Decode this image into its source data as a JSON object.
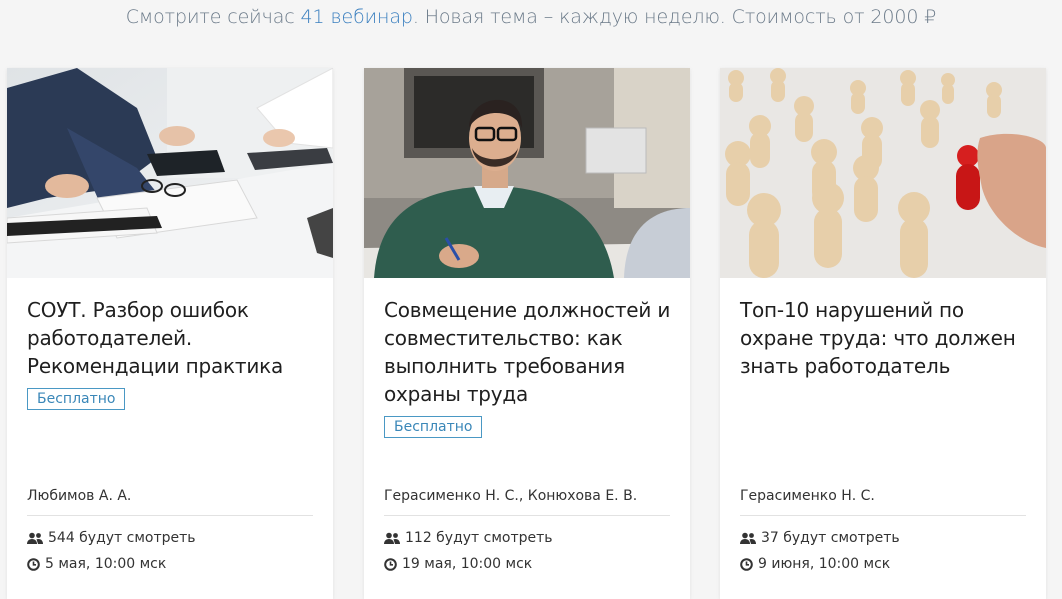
{
  "header": {
    "prefix": "Смотрите сейчас ",
    "count_link": "41 вебинар",
    "suffix": ". Новая тема – каждую неделю. Стоимость от 2000 ₽"
  },
  "cards": [
    {
      "image": "office-documents-tablet-calculator",
      "title": "СОУТ. Разбор ошибок работодателей. Рекомендации практика",
      "badge": "Бесплатно",
      "authors": "Любимов А. А.",
      "watchers": "544 будут смотреть",
      "date": "5 мая, 10:00 мск"
    },
    {
      "image": "man-signing-documents",
      "title": "Совмещение должностей и совместительство: как выполнить требования охраны труда",
      "badge": "Бесплатно",
      "authors": "Герасименко Н. С., Конюхова Е. В.",
      "watchers": "112 будут смотреть",
      "date": "19 мая, 10:00 мск"
    },
    {
      "image": "wooden-figures-red-figure",
      "title": "Топ-10 нарушений по охране труда: что должен знать работодатель",
      "badge": "",
      "authors": "Герасименко Н. С.",
      "watchers": "37 будут смотреть",
      "date": "9 июня, 10:00 мск"
    }
  ],
  "icons": {
    "watchers": "users-icon",
    "date": "clock-icon"
  },
  "colors": {
    "accent": "#3a87b8",
    "headline": "#6b7a89",
    "background": "#f5f5f5"
  }
}
